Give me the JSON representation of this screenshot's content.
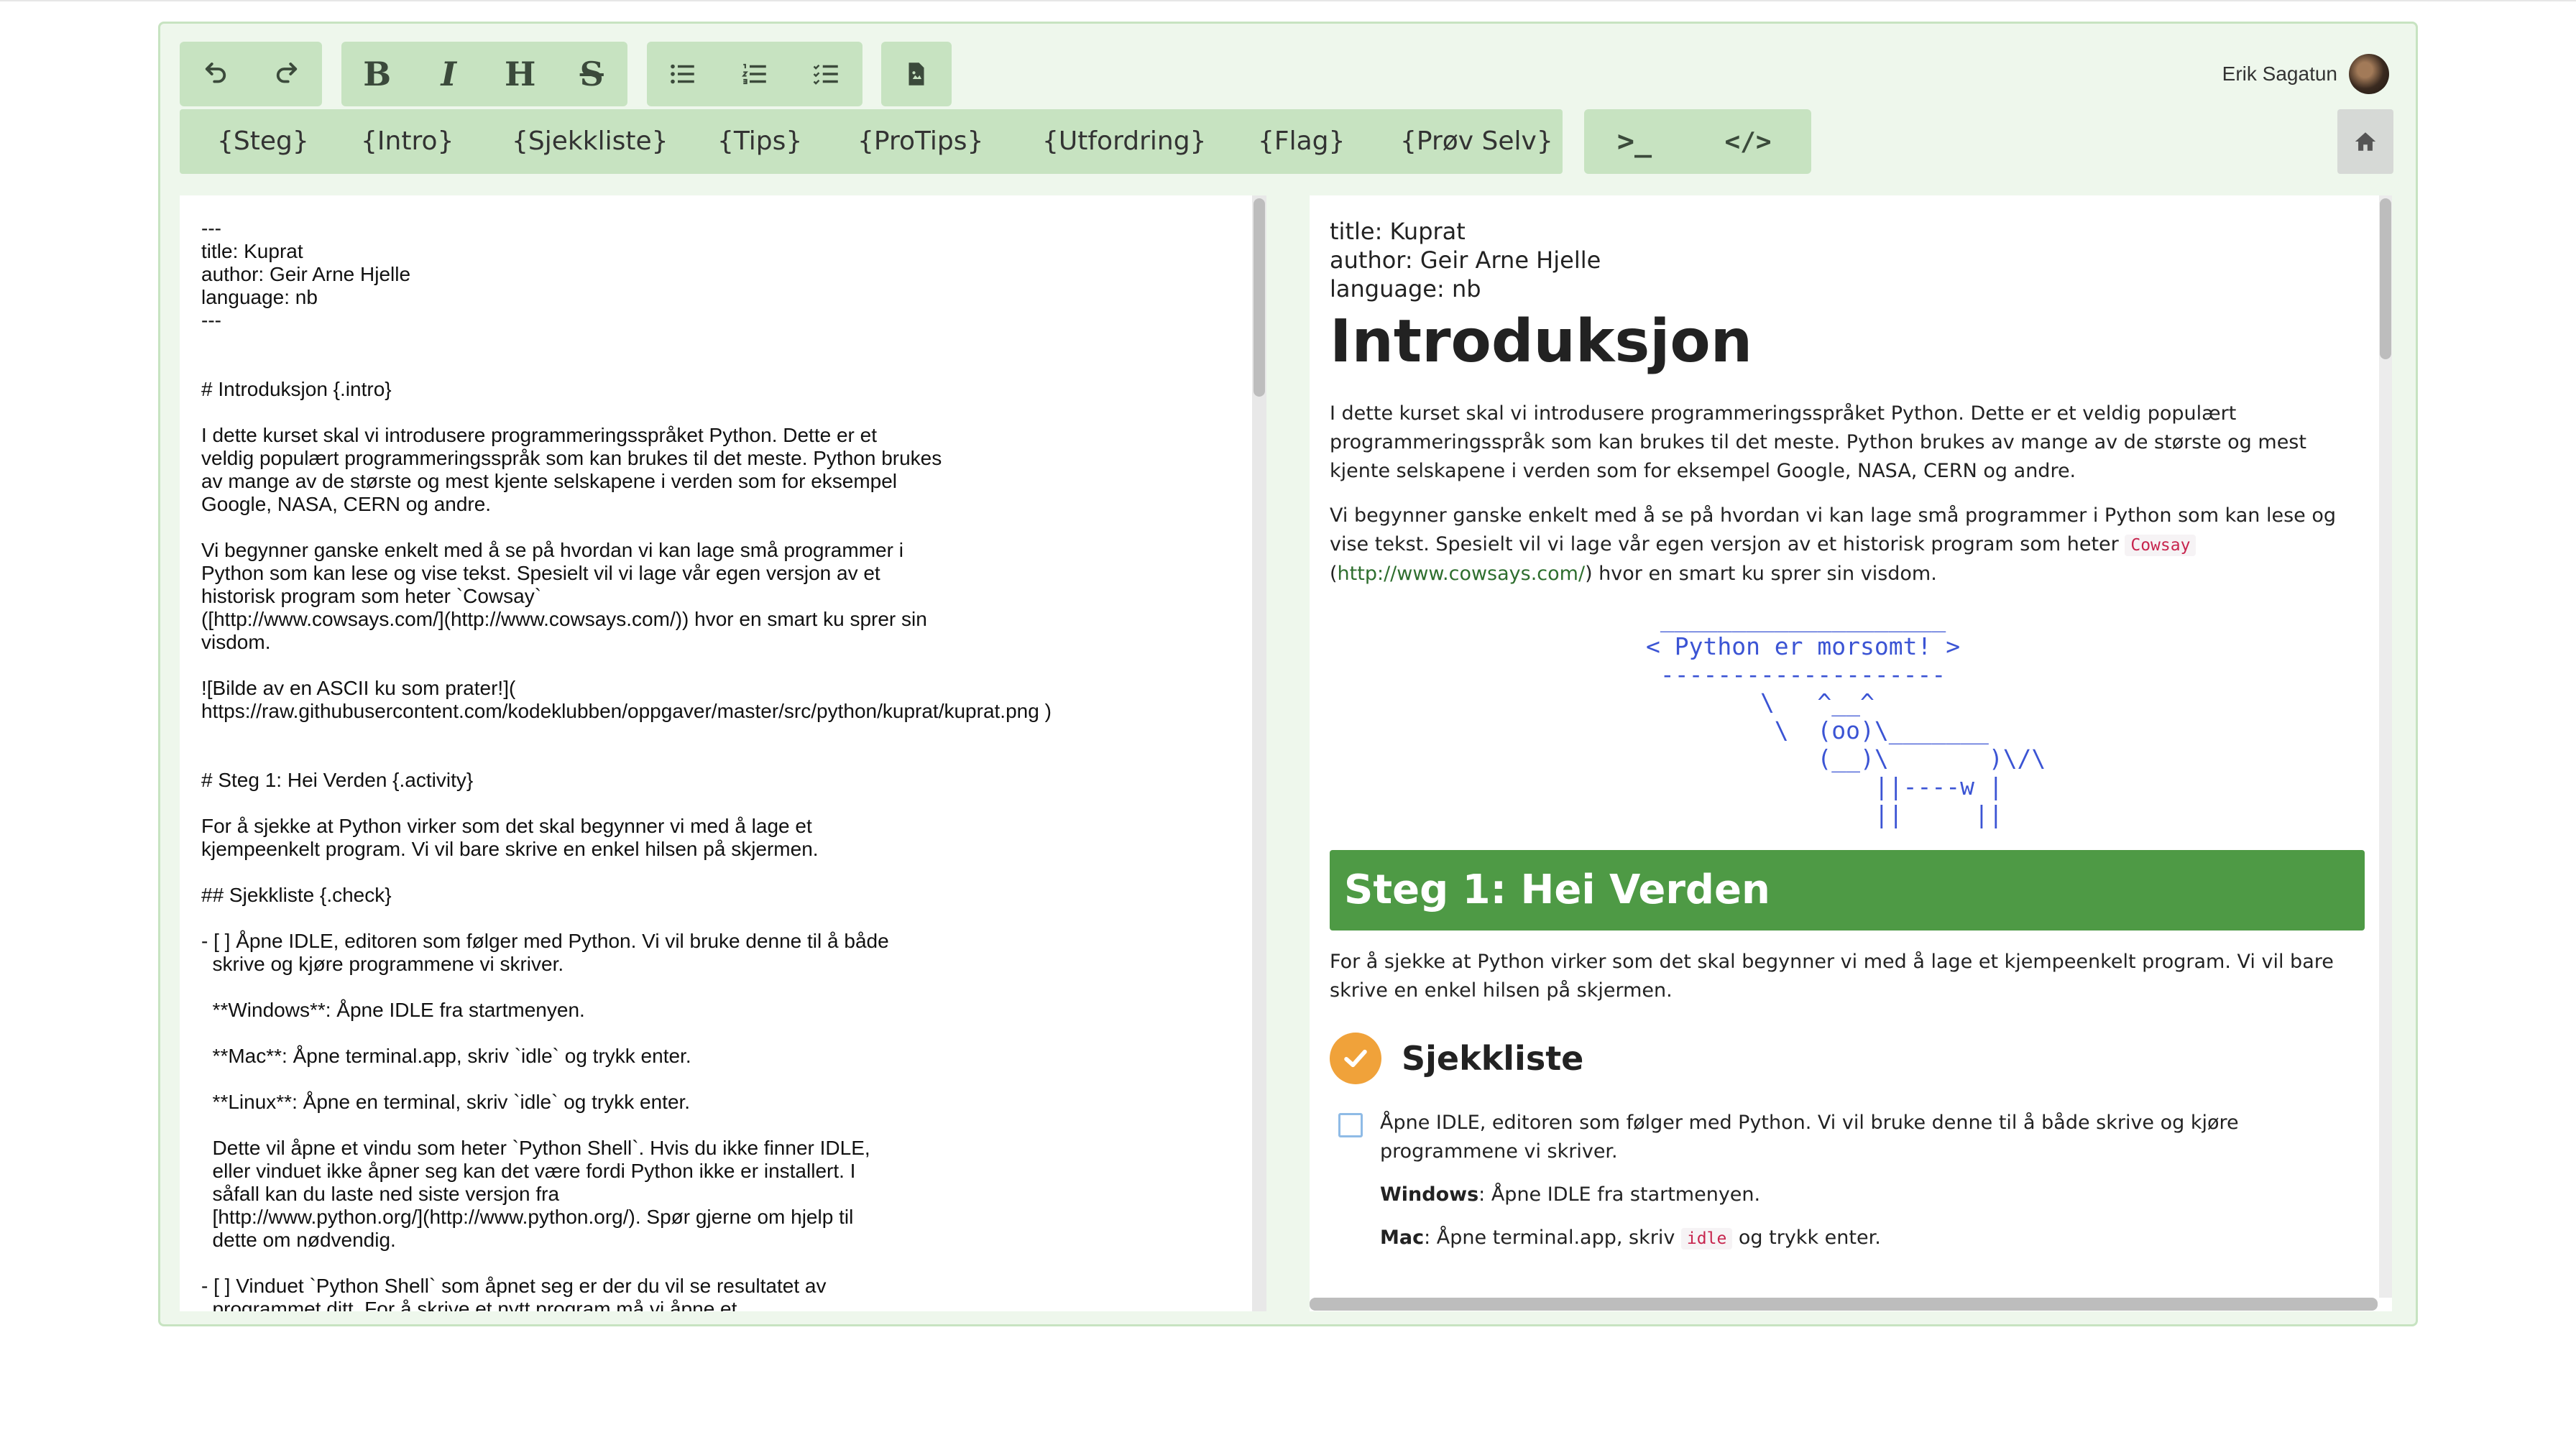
{
  "toolbar": {
    "undo_icon": "undo-icon",
    "redo_icon": "redo-icon",
    "bold": "B",
    "italic": "I",
    "heading": "H",
    "strikethrough": "S",
    "bullet_icon": "bullet-list-icon",
    "numbered_icon": "numbered-list-icon",
    "checklist_icon": "checklist-icon",
    "file_icon": "file-icon"
  },
  "tags": [
    "{Steg}",
    "{Intro}",
    "{Sjekkliste}",
    "{Tips}",
    "{ProTips}",
    "{Utfordring}",
    "{Flag}",
    "{Prøv Selv}"
  ],
  "code_buttons": {
    "terminal": ">_",
    "code": "</>"
  },
  "user": {
    "name": "Erik Sagatun"
  },
  "home_icon": "home-icon",
  "editor": {
    "lines": [
      "---",
      "title: Kuprat",
      "author: Geir Arne Hjelle",
      "language: nb",
      "---",
      "",
      "",
      "# Introduksjon {.intro}",
      "",
      "I dette kurset skal vi introdusere programmeringsspråket Python. Dette er et",
      "veldig populært programmeringsspråk som kan brukes til det meste. Python brukes",
      "av mange av de største og mest kjente selskapene i verden som for eksempel",
      "Google, NASA, CERN og andre.",
      "",
      "Vi begynner ganske enkelt med å se på hvordan vi kan lage små programmer i",
      "Python som kan lese og vise tekst. Spesielt vil vi lage vår egen versjon av et",
      "historisk program som heter `Cowsay`",
      "([http://www.cowsays.com/](http://www.cowsays.com/)) hvor en smart ku sprer sin",
      "visdom.",
      "",
      "![Bilde av en ASCII ku som prater!](",
      "https://raw.githubusercontent.com/kodeklubben/oppgaver/master/src/python/kuprat/kuprat.png )",
      "",
      "",
      "# Steg 1: Hei Verden {.activity}",
      "",
      "For å sjekke at Python virker som det skal begynner vi med å lage et",
      "kjempeenkelt program. Vi vil bare skrive en enkel hilsen på skjermen.",
      "",
      "## Sjekkliste {.check}",
      "",
      "- [ ] Åpne IDLE, editoren som følger med Python. Vi vil bruke denne til å både",
      "  skrive og kjøre programmene vi skriver.",
      "",
      "  **Windows**: Åpne IDLE fra startmenyen.",
      "",
      "  **Mac**: Åpne terminal.app, skriv `idle` og trykk enter.",
      "",
      "  **Linux**: Åpne en terminal, skriv `idle` og trykk enter.",
      "",
      "  Dette vil åpne et vindu som heter `Python Shell`. Hvis du ikke finner IDLE,",
      "  eller vinduet ikke åpner seg kan det være fordi Python ikke er installert. I",
      "  såfall kan du laste ned siste versjon fra",
      "  [http://www.python.org/](http://www.python.org/). Spør gjerne om hjelp til",
      "  dette om nødvendig.",
      "",
      "- [ ] Vinduet `Python Shell` som åpnet seg er der du vil se resultatet av",
      "  programmet ditt. For å skrive et nytt program må vi åpne et"
    ]
  },
  "preview": {
    "meta_title": "title: Kuprat",
    "meta_author": "author: Geir Arne Hjelle",
    "meta_language": "language: nb",
    "heading": "Introduksjon",
    "intro_p1": "I dette kurset skal vi introdusere programmeringsspråket Python. Dette er et veldig populært programmeringsspråk som kan brukes til det meste. Python brukes av mange av de største og mest kjente selskapene i verden som for eksempel Google, NASA, CERN og andre.",
    "intro_p2_a": "Vi begynner ganske enkelt med å se på hvordan vi kan lage små programmer i Python som kan lese og vise tekst. Spesielt vil vi lage vår egen versjon av et historisk program som heter",
    "intro_p2_code": "Cowsay",
    "intro_p2_open": "(",
    "intro_p2_link": "http://www.cowsays.com/",
    "intro_p2_b": ") hvor en smart ku sprer sin visdom.",
    "ascii_art": " ____________________\n< Python er morsomt! >\n --------------------\n        \\   ^__^\n         \\  (oo)\\_______\n            (__)\\       )\\/\\\n                ||----w |\n                ||     ||",
    "step_title": "Steg 1: Hei Verden",
    "step_p": "For å sjekke at Python virker som det skal begynner vi med å lage et kjempeenkelt program. Vi vil bare skrive en enkel hilsen på skjermen.",
    "check_heading": "Sjekkliste",
    "check_item_1": "Åpne IDLE, editoren som følger med Python. Vi vil bruke denne til å både skrive og kjøre programmene vi skriver.",
    "windows_label": "Windows",
    "windows_text": ": Åpne IDLE fra startmenyen.",
    "mac_label": "Mac",
    "mac_text_a": ": Åpne terminal.app, skriv",
    "mac_code": "idle",
    "mac_text_b": "og trykk enter."
  }
}
